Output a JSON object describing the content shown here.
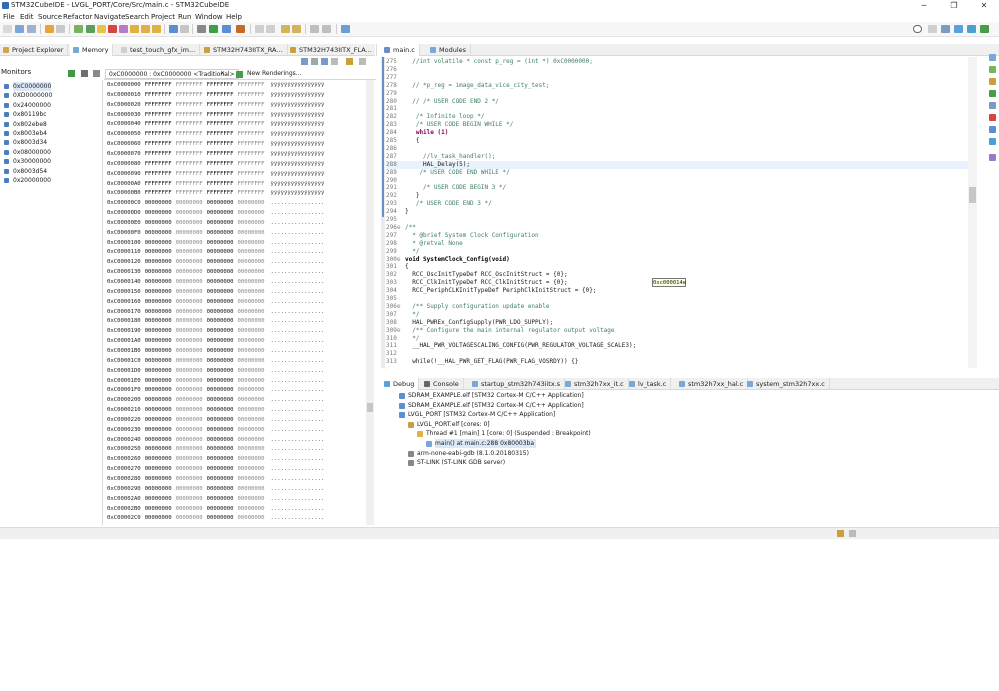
{
  "window": {
    "title": "STM32CubeIDE - LVGL_PORT/Core/Src/main.c - STM32CubeIDE"
  },
  "menu": [
    "File",
    "Edit",
    "Source",
    "Refactor",
    "Navigate",
    "Search",
    "Project",
    "Run",
    "Window",
    "Help"
  ],
  "left_tabs": [
    "Project Explorer",
    "Memory",
    "test_touch_gfx_im...",
    "STM32H743IITX_RA...",
    "STM32H743IITX_FLA..."
  ],
  "monitors": {
    "title": "Monitors",
    "items": [
      "0xC0000000",
      "0XD0000000",
      "0x24000000",
      "0x80119bc",
      "0x802ebe8",
      "0x8003eb4",
      "0x8003d34",
      "0x08000000",
      "0x30000000",
      "0x8003d54",
      "0x20000000"
    ]
  },
  "memory": {
    "rendering_tab": "0xC0000000 : 0xC0000000 <Traditional>",
    "new_rendering": "New Renderings...",
    "ff": "FFFFFFFF",
    "zz": "00000000",
    "ascii_y": "ÿÿÿÿÿÿÿÿÿÿÿÿÿÿÿÿ",
    "ascii_dot": "................",
    "addresses": [
      "0xC0000000",
      "0xC0000010",
      "0xC0000020",
      "0xC0000030",
      "0xC0000040",
      "0xC0000050",
      "0xC0000060",
      "0xC0000070",
      "0xC0000080",
      "0xC0000090",
      "0xC00000A0",
      "0xC00000B0",
      "0xC00000C0",
      "0xC00000D0",
      "0xC00000E0",
      "0xC00000F0",
      "0xC0000100",
      "0xC0000110",
      "0xC0000120",
      "0xC0000130",
      "0xC0000140",
      "0xC0000150",
      "0xC0000160",
      "0xC0000170",
      "0xC0000180",
      "0xC0000190",
      "0xC00001A0",
      "0xC00001B0",
      "0xC00001C0",
      "0xC00001D0",
      "0xC00001E0",
      "0xC00001F0",
      "0xC0000200",
      "0xC0000210",
      "0xC0000220",
      "0xC0000230",
      "0xC0000240",
      "0xC0000250",
      "0xC0000260",
      "0xC0000270",
      "0xC0000280",
      "0xC0000290",
      "0xC00002A0",
      "0xC00002B0",
      "0xC00002C0"
    ],
    "ff_row_count": 12
  },
  "editor_tabs": [
    "main.c",
    "Modules"
  ],
  "editor": {
    "lines": [
      {
        "n": "275",
        "t": "  //int volatile * const p_reg = (int *) 0xC0000000;",
        "c": "cm"
      },
      {
        "n": "276",
        "t": "",
        "c": ""
      },
      {
        "n": "277",
        "t": "",
        "c": ""
      },
      {
        "n": "278",
        "t": "  // *p_reg = image_data_vice_city_test;",
        "c": "cm"
      },
      {
        "n": "279",
        "t": "",
        "c": ""
      },
      {
        "n": "280",
        "t": "  // /* USER CODE END 2 */",
        "c": "cm"
      },
      {
        "n": "281",
        "t": "",
        "c": ""
      },
      {
        "n": "282",
        "t": "   /* Infinite loop */",
        "c": "cm"
      },
      {
        "n": "283",
        "t": "   /* USER CODE BEGIN WHILE */",
        "c": "cm"
      },
      {
        "n": "284",
        "t": "   while (1)",
        "c": "kw"
      },
      {
        "n": "285",
        "t": "   {",
        "c": ""
      },
      {
        "n": "286",
        "t": "",
        "c": ""
      },
      {
        "n": "287",
        "t": "     //lv_task_handler();",
        "c": "cm"
      },
      {
        "n": "288",
        "t": "     HAL_Delay(5);",
        "c": "hl"
      },
      {
        "n": "289",
        "t": "    /* USER CODE END WHILE */",
        "c": "cm"
      },
      {
        "n": "290",
        "t": "",
        "c": ""
      },
      {
        "n": "291",
        "t": "     /* USER CODE BEGIN 3 */",
        "c": "cm"
      },
      {
        "n": "292",
        "t": "   }",
        "c": ""
      },
      {
        "n": "293",
        "t": "   /* USER CODE END 3 */",
        "c": "cm"
      },
      {
        "n": "294",
        "t": "}",
        "c": ""
      },
      {
        "n": "295",
        "t": "",
        "c": ""
      },
      {
        "n": "296⊖",
        "t": "/**",
        "c": "cm"
      },
      {
        "n": "297",
        "t": "  * @brief System Clock Configuration",
        "c": "cm"
      },
      {
        "n": "298",
        "t": "  * @retval None",
        "c": "cm"
      },
      {
        "n": "299",
        "t": "  */",
        "c": "cm"
      },
      {
        "n": "300⊖",
        "t": "void SystemClock_Config(void)",
        "c": "fn"
      },
      {
        "n": "301",
        "t": "{",
        "c": ""
      },
      {
        "n": "302",
        "t": "  RCC_OscInitTypeDef RCC_OscInitStruct = {0};",
        "c": ""
      },
      {
        "n": "303",
        "t": "  RCC_ClkInitTypeDef RCC_ClkInitStruct = {0};",
        "c": ""
      },
      {
        "n": "304",
        "t": "  RCC_PeriphCLKInitTypeDef PeriphClkInitStruct = {0};",
        "c": ""
      },
      {
        "n": "305",
        "t": "",
        "c": ""
      },
      {
        "n": "306⊖",
        "t": "  /** Supply configuration update enable",
        "c": "cm"
      },
      {
        "n": "307",
        "t": "  */",
        "c": "cm"
      },
      {
        "n": "308",
        "t": "  HAL_PWREx_ConfigSupply(PWR_LDO_SUPPLY);",
        "c": ""
      },
      {
        "n": "309⊖",
        "t": "  /** Configure the main internal regulator output voltage",
        "c": "cm"
      },
      {
        "n": "310",
        "t": "  */",
        "c": "cm"
      },
      {
        "n": "311",
        "t": "  __HAL_PWR_VOLTAGESCALING_CONFIG(PWR_REGULATOR_VOLTAGE_SCALE3);",
        "c": ""
      },
      {
        "n": "312",
        "t": "",
        "c": ""
      },
      {
        "n": "313",
        "t": "  while(!__HAL_PWR_GET_FLAG(PWR_FLAG_VOSRDY)) {}",
        "c": ""
      }
    ],
    "hover_tip": "0xc000014e"
  },
  "debug_tabs": [
    "Debug",
    "Console",
    "startup_stm32h743iitx.s",
    "stm32h7xx_it.c",
    "lv_task.c",
    "stm32h7xx_hal.c",
    "system_stm32h7xx.c"
  ],
  "debug_tree": [
    {
      "label": "SDRAM_EXAMPLE.elf [STM32 Cortex-M C/C++ Application]",
      "indent": 0,
      "sel": false
    },
    {
      "label": "SDRAM_EXAMPLE.elf [STM32 Cortex-M C/C++ Application]",
      "indent": 0,
      "sel": false
    },
    {
      "label": "LVGL_PORT [STM32 Cortex-M C/C++ Application]",
      "indent": 0,
      "sel": false
    },
    {
      "label": "LVGL_PORT.elf [cores: 0]",
      "indent": 1,
      "sel": false
    },
    {
      "label": "Thread #1 [main] 1 [core: 0] (Suspended : Breakpoint)",
      "indent": 2,
      "sel": false
    },
    {
      "label": "main() at main.c:288 0x80003ba",
      "indent": 3,
      "sel": true
    },
    {
      "label": "arm-none-eabi-gdb (8.1.0.20180315)",
      "indent": 1,
      "sel": false
    },
    {
      "label": "ST-LINK (ST-LINK GDB server)",
      "indent": 1,
      "sel": false
    }
  ],
  "colors": {
    "accent": "#2d6db5",
    "selection": "#dbe8f7",
    "comment": "#3f7f5f",
    "keyword": "#7f0055"
  }
}
